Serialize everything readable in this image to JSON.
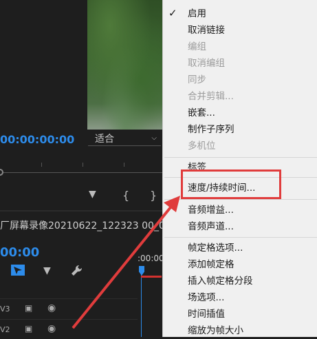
{
  "editor": {
    "program_timecode": "00:00:00:00",
    "fit_label": "适合",
    "sequence_title": "屏幕录像20210622_122323 00_0",
    "sequence_prefix": "厂",
    "sequence_timecode": "00:00",
    "timeline_ruler_label": ":00:00",
    "tracks": [
      "V3",
      "V2"
    ]
  },
  "context_menu": {
    "items": [
      {
        "label": "启用",
        "checked": true,
        "disabled": false
      },
      {
        "label": "取消链接",
        "disabled": false
      },
      {
        "label": "编组",
        "disabled": true
      },
      {
        "label": "取消编组",
        "disabled": true
      },
      {
        "label": "同步",
        "disabled": true
      },
      {
        "label": "合并剪辑...",
        "disabled": true
      },
      {
        "label": "嵌套...",
        "disabled": false
      },
      {
        "label": "制作子序列",
        "disabled": false
      },
      {
        "label": "多机位",
        "disabled": true
      },
      {
        "label": "标签",
        "disabled": false
      },
      {
        "label": "速度/持续时间...",
        "disabled": false,
        "highlighted": true
      },
      {
        "label": "音频增益...",
        "disabled": false
      },
      {
        "label": "音频声道...",
        "disabled": false
      },
      {
        "label": "帧定格选项...",
        "disabled": false
      },
      {
        "label": "添加帧定格",
        "disabled": false
      },
      {
        "label": "插入帧定格分段",
        "disabled": false
      },
      {
        "label": "场选项...",
        "disabled": false
      },
      {
        "label": "时间插值",
        "disabled": false
      },
      {
        "label": "缩放为帧大小",
        "disabled": false
      }
    ]
  },
  "colors": {
    "accent_blue": "#2d8ceb",
    "annotation_red": "#e03c3c",
    "menu_bg": "#f0f0f0"
  }
}
